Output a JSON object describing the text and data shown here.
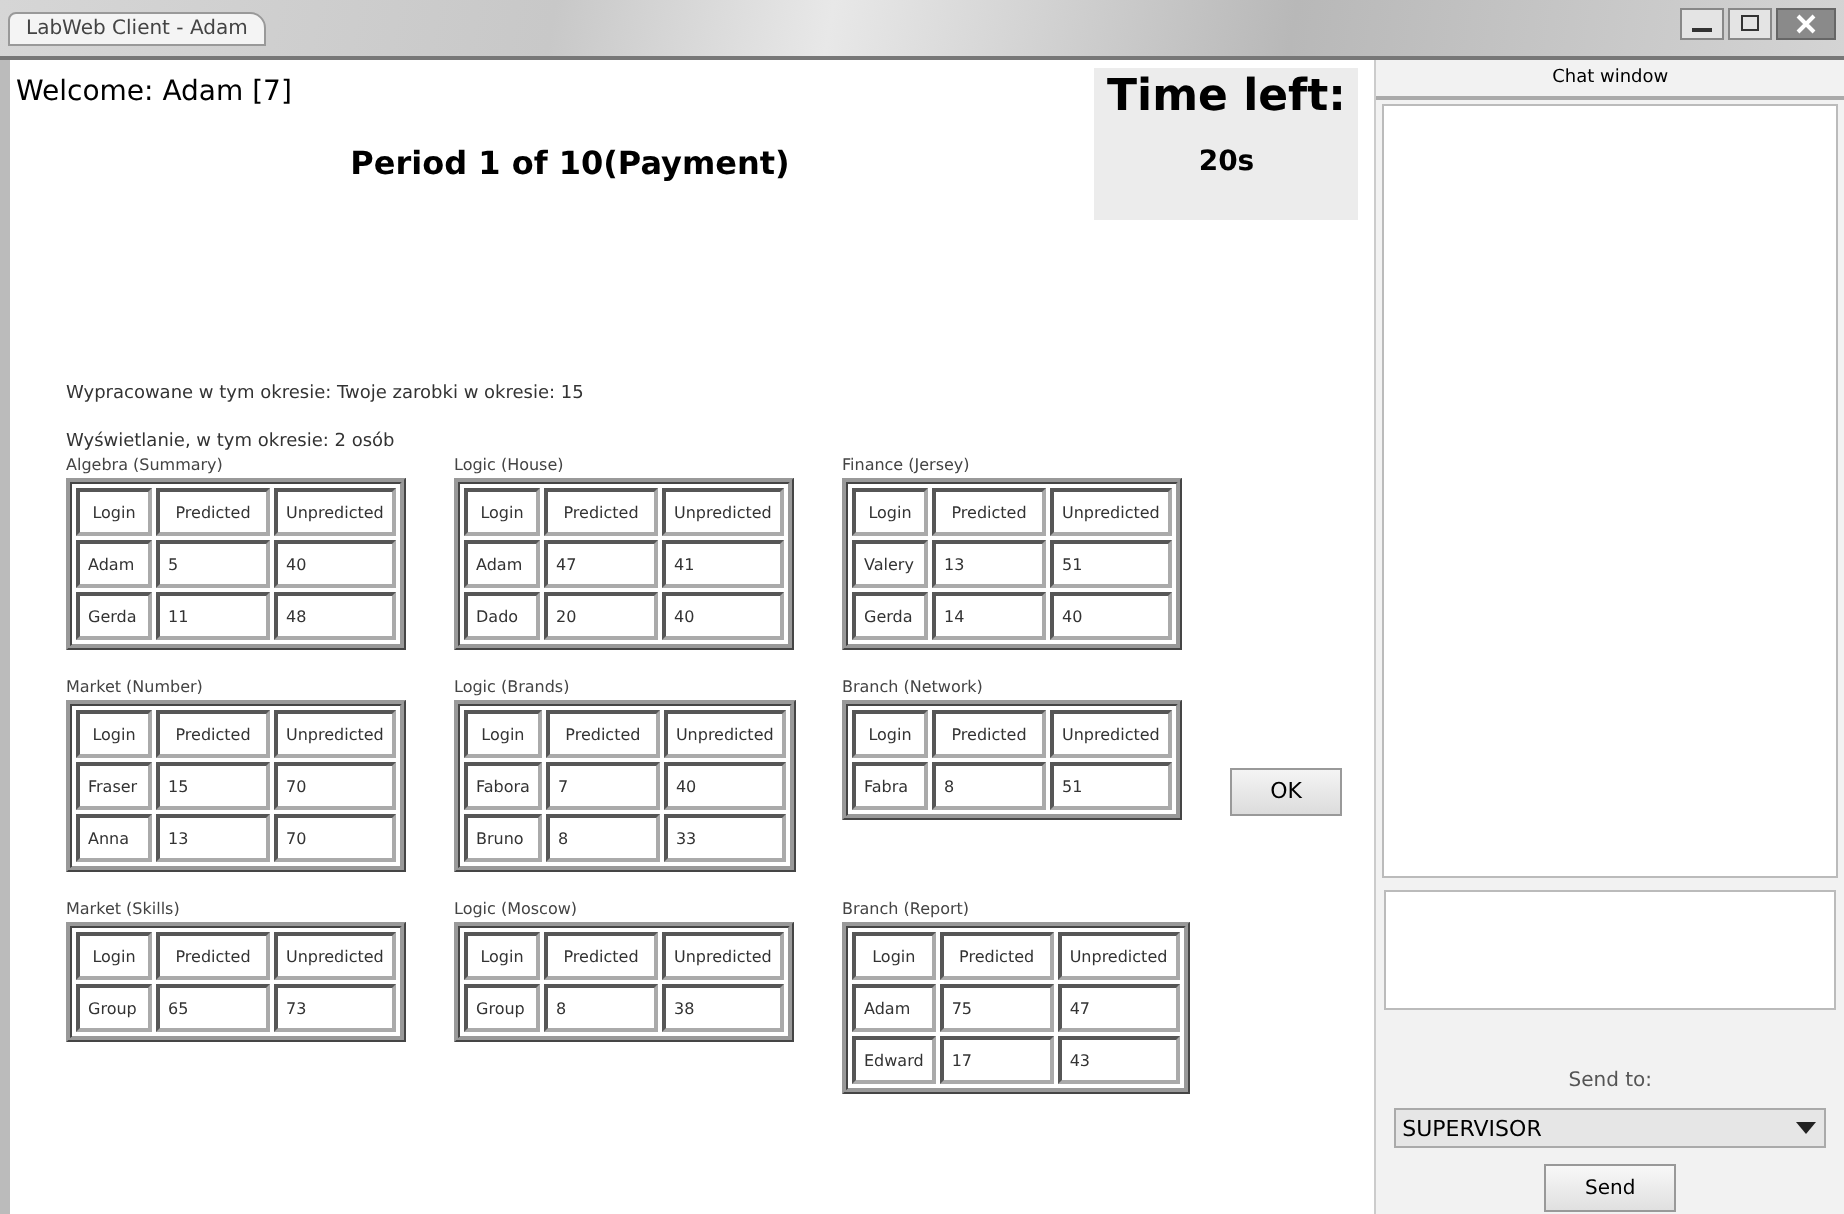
{
  "window": {
    "title": "LabWeb Client - Adam"
  },
  "welcome": "Welcome: Adam [7]",
  "period": "Period 1 of 10(Payment)",
  "timer": {
    "label": "Time left:",
    "value": "20s"
  },
  "info_lines": [
    "Wypracowane w tym okresie: Twoje zarobki w okresie: 15",
    "Wyświetlanie, w tym okresie: 2 osób"
  ],
  "tables": [
    {
      "title": "Algebra (Summary)",
      "columns": [
        "Login",
        "Predicted",
        "Unpredicted"
      ],
      "rows": [
        [
          "Adam",
          "5",
          "40"
        ],
        [
          "Gerda",
          "11",
          "48"
        ]
      ]
    },
    {
      "title": "Logic (House)",
      "columns": [
        "Login",
        "Predicted",
        "Unpredicted"
      ],
      "rows": [
        [
          "Adam",
          "47",
          "41"
        ],
        [
          "Dado",
          "20",
          "40"
        ]
      ]
    },
    {
      "title": "Finance (Jersey)",
      "columns": [
        "Login",
        "Predicted",
        "Unpredicted"
      ],
      "rows": [
        [
          "Valery",
          "13",
          "51"
        ],
        [
          "Gerda",
          "14",
          "40"
        ]
      ]
    },
    {
      "title": "Market (Number)",
      "columns": [
        "Login",
        "Predicted",
        "Unpredicted"
      ],
      "rows": [
        [
          "Fraser",
          "15",
          "70"
        ],
        [
          "Anna",
          "13",
          "70"
        ]
      ]
    },
    {
      "title": "Logic (Brands)",
      "columns": [
        "Login",
        "Predicted",
        "Unpredicted"
      ],
      "rows": [
        [
          "Fabora",
          "7",
          "40"
        ],
        [
          "Bruno",
          "8",
          "33"
        ]
      ]
    },
    {
      "title": "Branch (Network)",
      "columns": [
        "Login",
        "Predicted",
        "Unpredicted"
      ],
      "rows": [
        [
          "Fabra",
          "8",
          "51"
        ]
      ]
    },
    {
      "title": "Market (Skills)",
      "columns": [
        "Login",
        "Predicted",
        "Unpredicted"
      ],
      "rows": [
        [
          "Group",
          "65",
          "73"
        ]
      ]
    },
    {
      "title": "Logic (Moscow)",
      "columns": [
        "Login",
        "Predicted",
        "Unpredicted"
      ],
      "rows": [
        [
          "Group",
          "8",
          "38"
        ]
      ]
    },
    {
      "title": "Branch (Report)",
      "columns": [
        "Login",
        "Predicted",
        "Unpredicted"
      ],
      "rows": [
        [
          "Adam",
          "75",
          "47"
        ],
        [
          "Edward",
          "17",
          "43"
        ]
      ]
    }
  ],
  "ok_button": "OK",
  "chat": {
    "title": "Chat window",
    "send_to_label": "Send to:",
    "recipient": "SUPERVISOR",
    "send_button": "Send"
  }
}
